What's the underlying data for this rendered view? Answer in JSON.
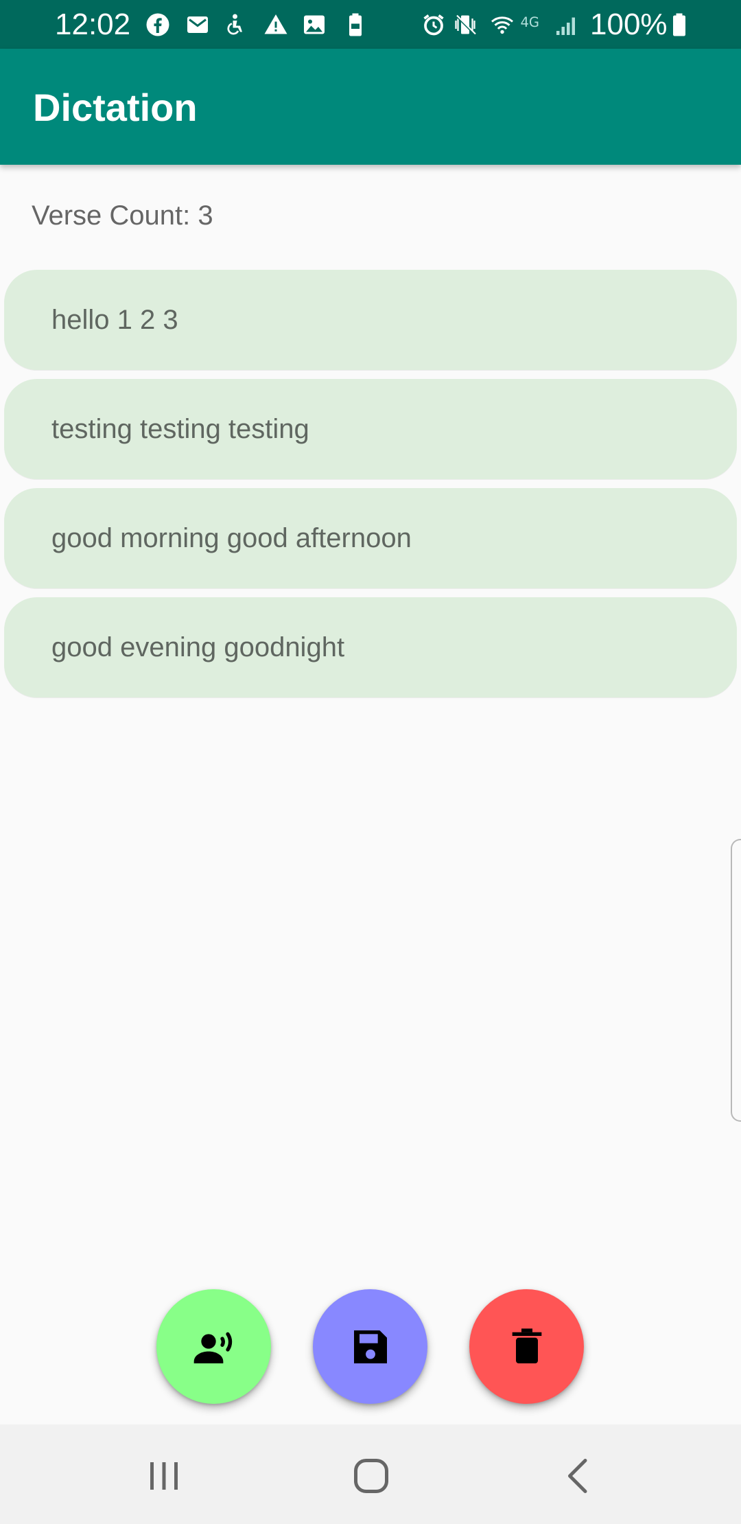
{
  "status_bar": {
    "time": "12:02",
    "battery_text": "100%",
    "network": "4G",
    "icons": [
      "facebook-icon",
      "gmail-icon",
      "accessibility-icon",
      "warning-icon",
      "image-icon",
      "battery-saver-icon",
      "alarm-icon",
      "vibrate-icon",
      "wifi-icon",
      "network-4g-icon",
      "signal-icon",
      "battery-icon"
    ],
    "background_color": "#00695c"
  },
  "app_bar": {
    "title": "Dictation",
    "background_color": "#00897b"
  },
  "main": {
    "verse_count_label": "Verse Count: 3",
    "verses": [
      {
        "text": "hello 1 2 3"
      },
      {
        "text": "testing testing testing"
      },
      {
        "text": "good morning good afternoon"
      },
      {
        "text": "good evening goodnight"
      }
    ],
    "verse_background_color": "#deeedd"
  },
  "actions": [
    {
      "name": "speak",
      "icon": "record-voice-icon",
      "color": "#88ff88"
    },
    {
      "name": "save",
      "icon": "save-icon",
      "color": "#8888ff"
    },
    {
      "name": "delete",
      "icon": "delete-icon",
      "color": "#ff5555"
    }
  ],
  "nav_bar": {
    "buttons": [
      "recents-icon",
      "home-icon",
      "back-icon"
    ]
  }
}
